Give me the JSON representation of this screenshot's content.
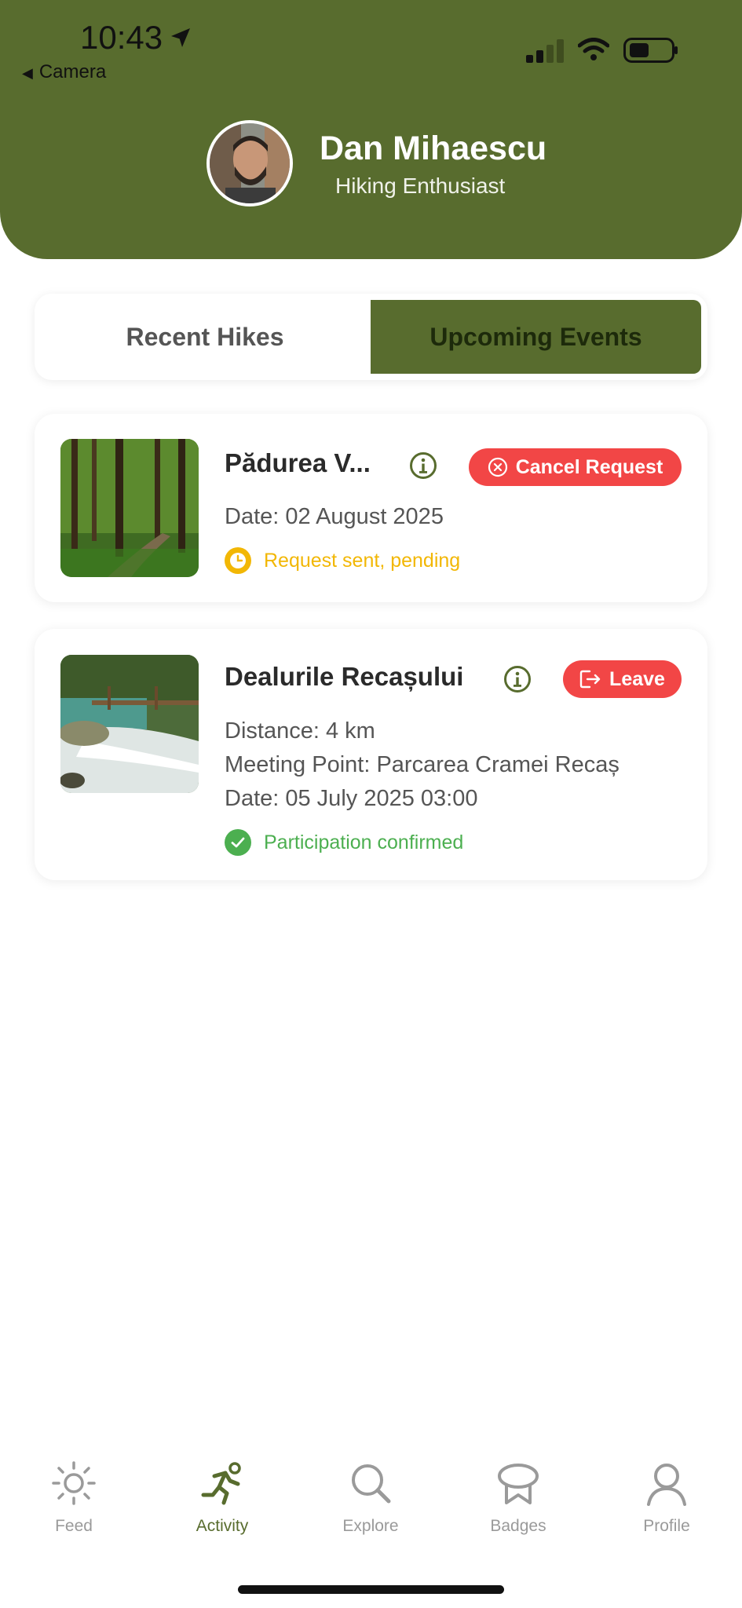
{
  "status_bar": {
    "time": "10:43",
    "back_label": "Camera"
  },
  "profile": {
    "name": "Dan Mihaescu",
    "subtitle": "Hiking Enthusiast"
  },
  "tabs": [
    {
      "label": "Recent Hikes",
      "active": false
    },
    {
      "label": "Upcoming Events",
      "active": true
    }
  ],
  "events": [
    {
      "title": "Pădurea V...",
      "action_label": "Cancel Request",
      "date": "Date: 02 August 2025",
      "status": "Request sent, pending"
    },
    {
      "title": "Dealurile Recașului",
      "action_label": "Leave",
      "distance": "Distance: 4 km",
      "meeting_point": "Meeting Point: Parcarea Cramei Recaș",
      "date": "Date: 05 July 2025 03:00",
      "status": "Participation confirmed"
    }
  ],
  "nav": [
    {
      "label": "Feed",
      "icon": "sun-icon"
    },
    {
      "label": "Activity",
      "icon": "running-icon",
      "active": true
    },
    {
      "label": "Explore",
      "icon": "search-icon"
    },
    {
      "label": "Badges",
      "icon": "badge-icon"
    },
    {
      "label": "Profile",
      "icon": "user-icon"
    }
  ],
  "colors": {
    "brand": "#586c2e",
    "danger": "#f24646",
    "pending": "#f2b705",
    "confirmed": "#4caf50"
  }
}
